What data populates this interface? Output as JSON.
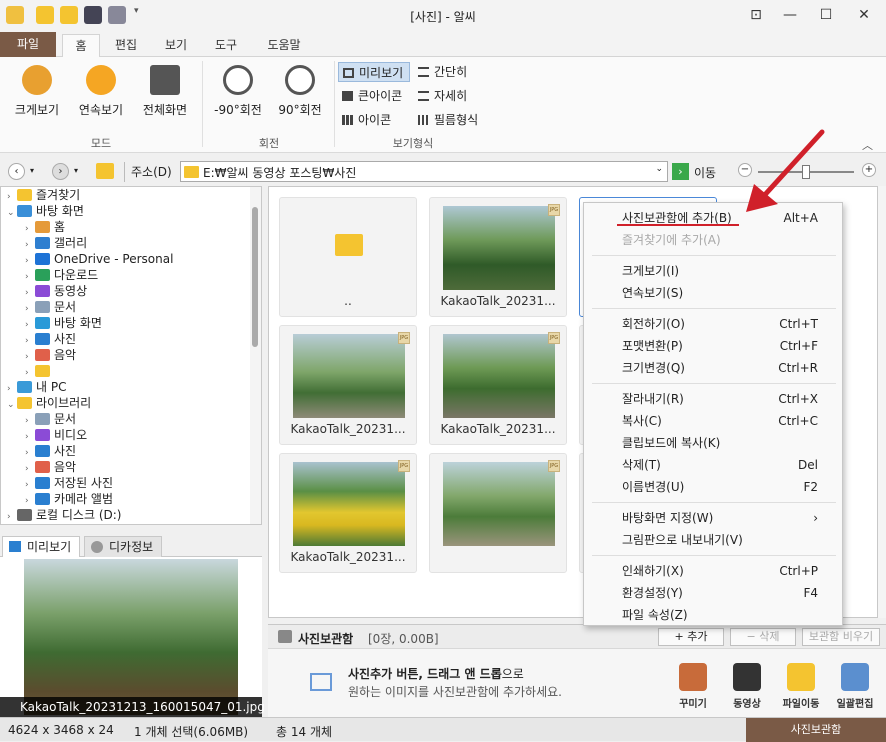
{
  "window": {
    "title": "[사진] - 알씨"
  },
  "ribbon_tabs": [
    "파일",
    "홈",
    "편집",
    "보기",
    "도구",
    "도움말"
  ],
  "ribbon": {
    "mode_buttons": [
      "크게보기",
      "연속보기",
      "전체화면"
    ],
    "mode_group": "모드",
    "rotate_buttons": [
      "-90°회전",
      "90°회전"
    ],
    "rotate_group": "회전",
    "view_options": [
      "미리보기",
      "간단히",
      "큰아이콘",
      "자세히",
      "아이콘",
      "필름형식"
    ],
    "view_group": "보기형식"
  },
  "address": {
    "label": "주소(D)",
    "path": "E:₩알씨 동영상 포스팅₩사진",
    "go": "이동"
  },
  "tree": [
    {
      "label": "즐겨찾기",
      "icon": "folder-icon",
      "color": "#f4c430"
    },
    {
      "label": "바탕 화면",
      "icon": "desktop-icon",
      "color": "#3a8fd8"
    },
    {
      "label": "홈",
      "icon": "home-icon",
      "color": "#e59a3a"
    },
    {
      "label": "갤러리",
      "icon": "gallery-icon",
      "color": "#2f7fd0"
    },
    {
      "label": "OneDrive - Personal",
      "icon": "cloud-icon",
      "color": "#1e73d6"
    },
    {
      "label": "다운로드",
      "icon": "download-icon",
      "color": "#2aa05a"
    },
    {
      "label": "동영상",
      "icon": "video-icon",
      "color": "#8b4bd6"
    },
    {
      "label": "문서",
      "icon": "document-icon",
      "color": "#8aa0b8"
    },
    {
      "label": "바탕 화면",
      "icon": "desktop-icon",
      "color": "#2a9ad8"
    },
    {
      "label": "사진",
      "icon": "picture-icon",
      "color": "#2a7fd0"
    },
    {
      "label": "음악",
      "icon": "music-icon",
      "color": "#e0604a"
    },
    {
      "label": "",
      "icon": "folder-icon",
      "color": "#f4c430"
    },
    {
      "label": "내 PC",
      "icon": "pc-icon",
      "color": "#3a9ad8"
    },
    {
      "label": "라이브러리",
      "icon": "folder-icon",
      "color": "#f4c430"
    },
    {
      "label": "문서",
      "icon": "document-icon",
      "color": "#8aa0b8"
    },
    {
      "label": "비디오",
      "icon": "video-icon",
      "color": "#8b4bd6"
    },
    {
      "label": "사진",
      "icon": "picture-icon",
      "color": "#2a7fd0"
    },
    {
      "label": "음악",
      "icon": "music-icon",
      "color": "#e0604a"
    },
    {
      "label": "저장된 사진",
      "icon": "picture-icon",
      "color": "#2a7fd0"
    },
    {
      "label": "카메라 앨범",
      "icon": "picture-icon",
      "color": "#2a7fd0"
    },
    {
      "label": "로컬 디스크 (D:)",
      "icon": "disk-icon",
      "color": "#666666"
    }
  ],
  "preview": {
    "tabs": [
      "미리보기",
      "디카정보"
    ],
    "caption": "KakaoTalk_20231213_160015047_01.jpg"
  },
  "status": {
    "dims": "4624 x 3468 x 24",
    "selection": "1 개체 선택(6.06MB)",
    "total": "총 14 개체",
    "album_tab": "사진보관함"
  },
  "grid": {
    "items": [
      {
        "caption": "..",
        "type": "folder"
      },
      {
        "caption": "KakaoTalk_20231...",
        "type": "jpg"
      },
      {
        "caption": "",
        "type": "jpg"
      },
      {
        "caption": "KakaoTalk_20231...",
        "type": "jpg"
      },
      {
        "caption": "KakaoTalk_20231...",
        "type": "jpg"
      },
      {
        "caption": "KakaoTalk_20231...",
        "type": "jpg"
      },
      {
        "caption": "KakaoTalk_20231...",
        "type": "jpg"
      },
      {
        "caption": "",
        "type": "jpg"
      },
      {
        "caption": "",
        "type": "jpg"
      }
    ]
  },
  "album": {
    "title": "사진보관함",
    "count": "[0장, 0.00B]",
    "add": "추가",
    "delete": "삭제",
    "clear": "보관함 비우기",
    "hint_bold": "사진추가 버튼, 드래그 앤 드롭",
    "hint_rest": "으로",
    "hint2": "원하는 이미지를 사진보관함에 추가하세요.",
    "tools": [
      "꾸미기",
      "동영상",
      "파일이동",
      "일괄편집"
    ]
  },
  "context_menu": [
    {
      "label": "사진보관함에 추가(B)",
      "shortcut": "Alt+A"
    },
    {
      "label": "즐겨찾기에 추가(A)",
      "shortcut": "",
      "disabled": true
    },
    {
      "sep": true
    },
    {
      "label": "크게보기(I)",
      "shortcut": ""
    },
    {
      "label": "연속보기(S)",
      "shortcut": ""
    },
    {
      "sep": true
    },
    {
      "label": "회전하기(O)",
      "shortcut": "Ctrl+T"
    },
    {
      "label": "포맷변환(P)",
      "shortcut": "Ctrl+F"
    },
    {
      "label": "크기변경(Q)",
      "shortcut": "Ctrl+R"
    },
    {
      "sep": true
    },
    {
      "label": "잘라내기(R)",
      "shortcut": "Ctrl+X"
    },
    {
      "label": "복사(C)",
      "shortcut": "Ctrl+C"
    },
    {
      "label": "클립보드에 복사(K)",
      "shortcut": ""
    },
    {
      "label": "삭제(T)",
      "shortcut": "Del"
    },
    {
      "label": "이름변경(U)",
      "shortcut": "F2"
    },
    {
      "sep": true
    },
    {
      "label": "바탕화면 지정(W)",
      "shortcut": "›"
    },
    {
      "label": "그림판으로 내보내기(V)",
      "shortcut": ""
    },
    {
      "sep": true
    },
    {
      "label": "인쇄하기(X)",
      "shortcut": "Ctrl+P"
    },
    {
      "label": "환경설정(Y)",
      "shortcut": "F4"
    },
    {
      "label": "파일 속성(Z)",
      "shortcut": ""
    }
  ],
  "colors": {
    "accent": "#7a5a46",
    "highlight": "#d0202a",
    "selection": "#4a88d8"
  }
}
